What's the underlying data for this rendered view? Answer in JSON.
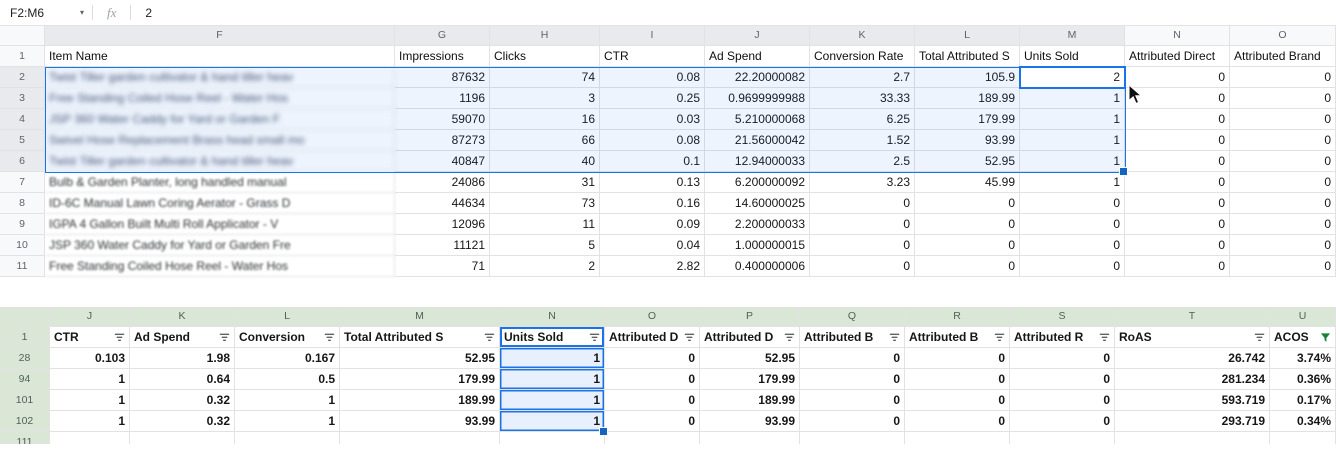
{
  "formula_bar": {
    "range": "F2:M6",
    "fx_label": "fx",
    "value": "2"
  },
  "top_sheet": {
    "column_letters": [
      "F",
      "G",
      "H",
      "I",
      "J",
      "K",
      "L",
      "M",
      "N",
      "O"
    ],
    "rows": [
      {
        "n": "1",
        "cells": [
          "Item Name",
          "Impressions",
          "Clicks",
          "CTR",
          "Ad Spend",
          "Conversion Rate",
          "Total Attributed S",
          "Units Sold",
          "Attributed Direct",
          "Attributed Brand"
        ]
      },
      {
        "n": "2",
        "cells": [
          "Twist Tiller garden cultivator & hand tiller heav",
          "87632",
          "74",
          "0.08",
          "22.20000082",
          "2.7",
          "105.9",
          "2",
          "0",
          "0"
        ]
      },
      {
        "n": "3",
        "cells": [
          "Free Standing Coiled Hose Reel - Water Hos",
          "1196",
          "3",
          "0.25",
          "0.9699999988",
          "33.33",
          "189.99",
          "1",
          "0",
          "0"
        ]
      },
      {
        "n": "4",
        "cells": [
          "JSP 360 Water Caddy for Yard or Garden F",
          "59070",
          "16",
          "0.03",
          "5.210000068",
          "6.25",
          "179.99",
          "1",
          "0",
          "0"
        ]
      },
      {
        "n": "5",
        "cells": [
          "Swivel Hose Replacement Brass head small mo",
          "87273",
          "66",
          "0.08",
          "21.56000042",
          "1.52",
          "93.99",
          "1",
          "0",
          "0"
        ]
      },
      {
        "n": "6",
        "cells": [
          "Twist Tiller garden cultivator & hand tiller heav",
          "40847",
          "40",
          "0.1",
          "12.94000033",
          "2.5",
          "52.95",
          "1",
          "0",
          "0"
        ]
      },
      {
        "n": "7",
        "cells": [
          "Bulb & Garden Planter, long handled manual",
          "24086",
          "31",
          "0.13",
          "6.200000092",
          "3.23",
          "45.99",
          "1",
          "0",
          "0"
        ]
      },
      {
        "n": "8",
        "cells": [
          "ID-6C Manual Lawn Coring Aerator - Grass D",
          "44634",
          "73",
          "0.16",
          "14.60000025",
          "0",
          "0",
          "0",
          "0",
          "0"
        ]
      },
      {
        "n": "9",
        "cells": [
          "IGPA 4 Gallon Built Multi Roll Applicator - V",
          "12096",
          "11",
          "0.09",
          "2.200000033",
          "0",
          "0",
          "0",
          "0",
          "0"
        ]
      },
      {
        "n": "10",
        "cells": [
          "JSP 360 Water Caddy for Yard or Garden Fre",
          "11121",
          "5",
          "0.04",
          "1.000000015",
          "0",
          "0",
          "0",
          "0",
          "0"
        ]
      },
      {
        "n": "11",
        "cells": [
          "Free Standing Coiled Hose Reel - Water Hos",
          "71",
          "2",
          "2.82",
          "0.400000006",
          "0",
          "0",
          "0",
          "0",
          "0"
        ]
      }
    ]
  },
  "bottom_sheet": {
    "column_letters": [
      "J",
      "K",
      "L",
      "M",
      "N",
      "O",
      "P",
      "Q",
      "R",
      "S",
      "T",
      "U"
    ],
    "active_filter_label": "ACOS",
    "header_row": {
      "n": "1",
      "labels": [
        "CTR",
        "Ad Spend",
        "Conversion",
        "Total Attributed S",
        "Units Sold",
        "Attributed D",
        "Attributed D",
        "Attributed B",
        "Attributed B",
        "Attributed R",
        "RoAS",
        "ACOS"
      ]
    },
    "rows": [
      {
        "n": "28",
        "cells": [
          "0.103",
          "1.98",
          "0.167",
          "52.95",
          "1",
          "0",
          "52.95",
          "0",
          "0",
          "0",
          "26.742",
          "3.74%"
        ]
      },
      {
        "n": "94",
        "cells": [
          "1",
          "0.64",
          "0.5",
          "179.99",
          "1",
          "0",
          "179.99",
          "0",
          "0",
          "0",
          "281.234",
          "0.36%"
        ]
      },
      {
        "n": "101",
        "cells": [
          "1",
          "0.32",
          "1",
          "189.99",
          "1",
          "0",
          "189.99",
          "0",
          "0",
          "0",
          "593.719",
          "0.17%"
        ]
      },
      {
        "n": "102",
        "cells": [
          "1",
          "0.32",
          "1",
          "93.99",
          "1",
          "0",
          "93.99",
          "0",
          "0",
          "0",
          "293.719",
          "0.34%"
        ]
      }
    ],
    "partial_row_number": "111"
  }
}
